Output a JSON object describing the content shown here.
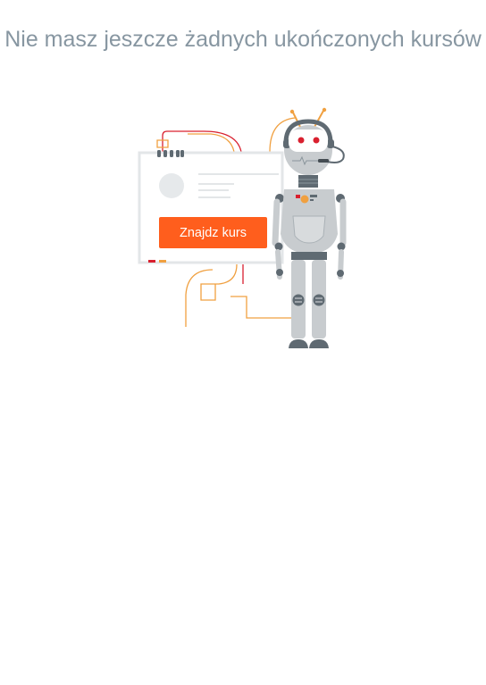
{
  "empty_state": {
    "title": "Nie masz jeszcze żadnych ukończonych kursów",
    "button_label": "Znajdz kurs"
  },
  "colors": {
    "title": "#8796a1",
    "accent": "#ff5e1d",
    "line_orange": "#f0a040",
    "line_red": "#d9202f",
    "robot_body": "#c8cccf",
    "robot_dark": "#5f6a72"
  },
  "icons": [
    "robot-illustration",
    "browser-window-illustration"
  ]
}
